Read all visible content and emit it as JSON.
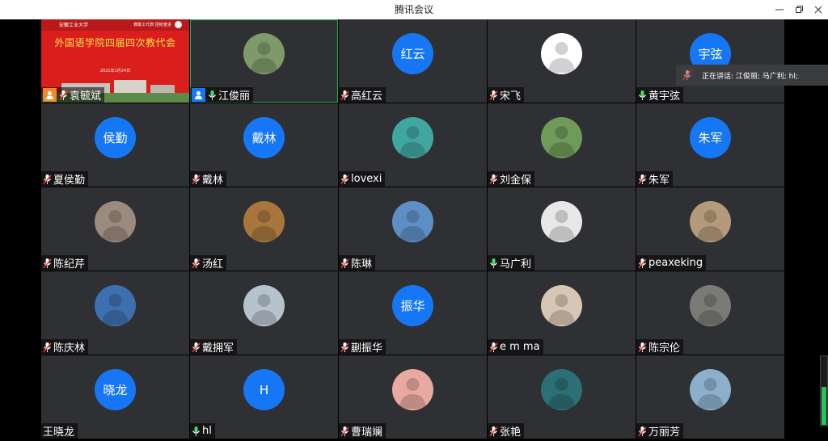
{
  "window": {
    "title": "腾讯会议"
  },
  "speaking": {
    "text": "正在讲话: 江俊丽; 马广利; hl;"
  },
  "banner": {
    "headline": "外国语学院四届四次教代会",
    "university": "安徽工业大学",
    "date": "2021年1月24日",
    "note": "教职工代表  团结奋进"
  },
  "input_level": 0.55,
  "participants": [
    {
      "name": "袁毓斌",
      "avatar": "banner",
      "mic": "muted",
      "host": "orange"
    },
    {
      "name": "江俊丽",
      "avatar": "photo",
      "photo_color": "#7f9a6a",
      "mic": "on",
      "host": "blue",
      "speaking": true
    },
    {
      "name": "高红云",
      "avatar": "text",
      "avatar_text": "红云",
      "mic": "muted"
    },
    {
      "name": "宋飞",
      "avatar": "photo",
      "photo_color": "#ffffff",
      "mic": "muted"
    },
    {
      "name": "黄宇弦",
      "avatar": "text",
      "avatar_text": "宇弦",
      "mic": "on"
    },
    {
      "name": "夏侯勤",
      "avatar": "text",
      "avatar_text": "侯勤",
      "mic": "muted"
    },
    {
      "name": "戴林",
      "avatar": "text",
      "avatar_text": "戴林",
      "mic": "muted"
    },
    {
      "name": "lovexi",
      "avatar": "photo",
      "photo_color": "#3fa7a0",
      "mic": "muted"
    },
    {
      "name": "刘金保",
      "avatar": "photo",
      "photo_color": "#6f9a5a",
      "mic": "muted"
    },
    {
      "name": "朱军",
      "avatar": "text",
      "avatar_text": "朱军",
      "mic": "muted"
    },
    {
      "name": "陈纪芹",
      "avatar": "photo",
      "photo_color": "#9c8a7e",
      "mic": "muted"
    },
    {
      "name": "汤红",
      "avatar": "photo",
      "photo_color": "#a8763c",
      "mic": "muted"
    },
    {
      "name": "陈琳",
      "avatar": "photo",
      "photo_color": "#5d8fc6",
      "mic": "muted"
    },
    {
      "name": "马广利",
      "avatar": "photo",
      "photo_color": "#e8e8ea",
      "mic": "on"
    },
    {
      "name": "peaxeking",
      "avatar": "photo",
      "photo_color": "#b49a7a",
      "mic": "muted"
    },
    {
      "name": "陈庆林",
      "avatar": "photo",
      "photo_color": "#3e6fae",
      "mic": "muted"
    },
    {
      "name": "戴拥军",
      "avatar": "photo",
      "photo_color": "#b7c3cc",
      "mic": "muted"
    },
    {
      "name": "蒯振华",
      "avatar": "text",
      "avatar_text": "振华",
      "mic": "muted"
    },
    {
      "name": "e m ma",
      "avatar": "photo",
      "photo_color": "#d8c6b4",
      "mic": "muted"
    },
    {
      "name": "陈宗伦",
      "avatar": "photo",
      "photo_color": "#7a7a76",
      "mic": "muted"
    },
    {
      "name": "王晓龙",
      "avatar": "text",
      "avatar_text": "晓龙",
      "mic": "none"
    },
    {
      "name": "hl",
      "avatar": "text",
      "avatar_text": "H",
      "mic": "on"
    },
    {
      "name": "曹瑞斓",
      "avatar": "photo",
      "photo_color": "#e9a9a0",
      "mic": "muted"
    },
    {
      "name": "张艳",
      "avatar": "photo",
      "photo_color": "#2c6f74",
      "mic": "muted"
    },
    {
      "name": "万丽芳",
      "avatar": "photo",
      "photo_color": "#8cb0cc",
      "mic": "muted"
    }
  ]
}
